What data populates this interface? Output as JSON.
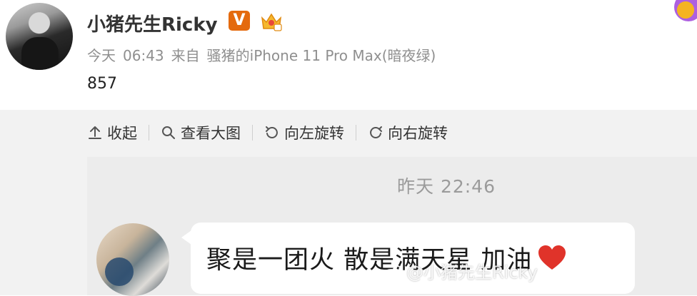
{
  "post": {
    "username": "小猪先生Ricky",
    "vip_badge": "V",
    "meta": {
      "day": "今天",
      "time": "06:43",
      "source_prefix": "来自",
      "source": "骚猪的iPhone 11 Pro Max(暗夜绿)"
    },
    "text": "857"
  },
  "toolbar": {
    "items": [
      {
        "label": "收起",
        "icon": "arrow-up-icon"
      },
      {
        "label": "查看大图",
        "icon": "search-icon"
      },
      {
        "label": "向左旋转",
        "icon": "rotate-left-icon"
      },
      {
        "label": "向右旋转",
        "icon": "rotate-right-icon"
      }
    ]
  },
  "image": {
    "chat_time": "昨天 22:46",
    "message": "聚是一团火 散是满天星 加油",
    "watermark": "@小猪先生Ricky"
  },
  "colors": {
    "vip_orange": "#e46a0e",
    "heart_red": "#e0332a",
    "meta_gray": "#8f8f8f"
  }
}
